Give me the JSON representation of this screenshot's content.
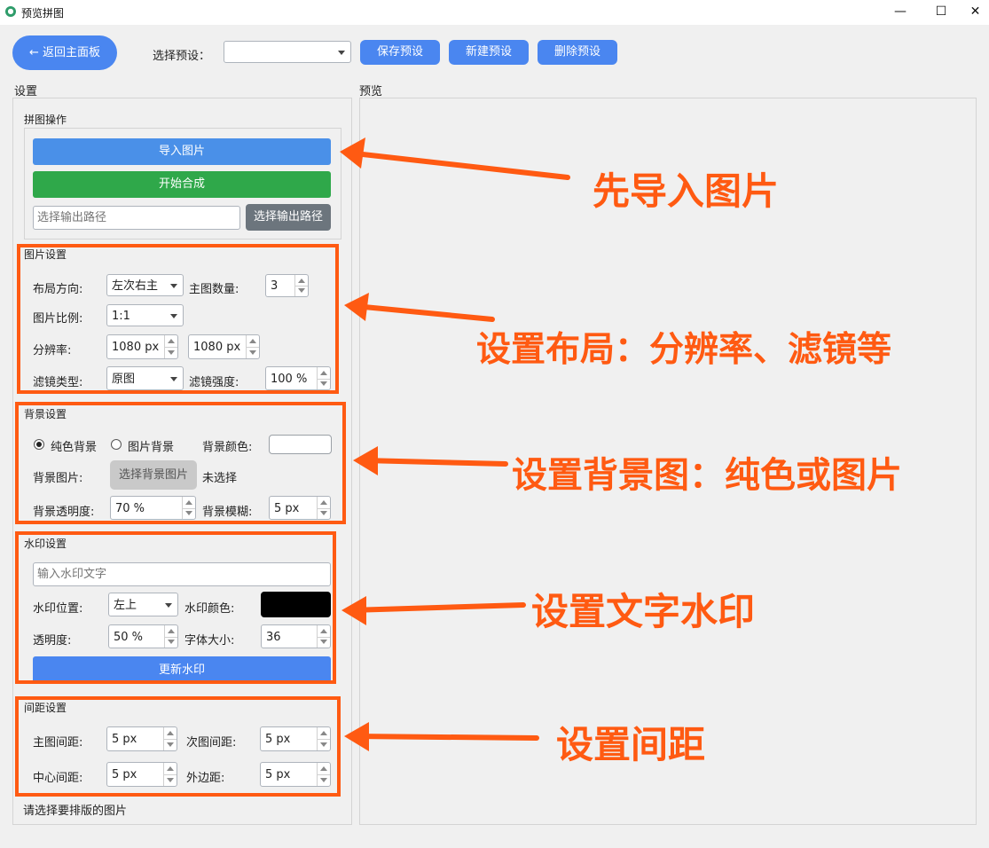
{
  "window": {
    "title": "预览拼图",
    "minimize": "—",
    "maximize": "☐",
    "close": "✕"
  },
  "toolbar": {
    "back_label": "← 返回主面板",
    "preset_label": "选择预设：",
    "preset_value": "",
    "save_label": "保存预设",
    "new_label": "新建预设",
    "delete_label": "删除预设"
  },
  "settings_title": "设置",
  "preview_title": "预览",
  "ops": {
    "title": "拼图操作",
    "import_label": "导入图片",
    "compose_label": "开始合成",
    "output_placeholder": "选择输出路径",
    "output_button": "选择输出路径"
  },
  "image_settings": {
    "title": "图片设置",
    "layout_label": "布局方向:",
    "layout_value": "左次右主",
    "main_count_label": "主图数量:",
    "main_count_value": "3",
    "ratio_label": "图片比例:",
    "ratio_value": "1:1",
    "resolution_label": "分辨率:",
    "res_w": "1080 px",
    "res_h": "1080 px",
    "filter_label": "滤镜类型:",
    "filter_value": "原图",
    "filter_strength_label": "滤镜强度:",
    "filter_strength_value": "100 %"
  },
  "background": {
    "title": "背景设置",
    "solid_label": "纯色背景",
    "image_label": "图片背景",
    "color_label": "背景颜色:",
    "color_value": "#ffffff",
    "bg_image_label": "背景图片:",
    "choose_bg_button": "选择背景图片",
    "not_selected": "未选择",
    "opacity_label": "背景透明度:",
    "opacity_value": "70 %",
    "blur_label": "背景模糊:",
    "blur_value": "5 px"
  },
  "watermark": {
    "title": "水印设置",
    "text_placeholder": "输入水印文字",
    "position_label": "水印位置:",
    "position_value": "左上",
    "color_label": "水印颜色:",
    "color_value": "#000000",
    "opacity_label": "透明度:",
    "opacity_value": "50 %",
    "font_size_label": "字体大小:",
    "font_size_value": "36",
    "update_button": "更新水印"
  },
  "spacing": {
    "title": "间距设置",
    "main_gap_label": "主图间距:",
    "main_gap_value": "5 px",
    "sub_gap_label": "次图间距:",
    "sub_gap_value": "5 px",
    "center_gap_label": "中心间距:",
    "center_gap_value": "5 px",
    "outer_margin_label": "外边距:",
    "outer_margin_value": "5 px"
  },
  "status_text": "请选择要排版的图片",
  "annotations": {
    "import": "先导入图片",
    "layout": "设置布局：分辨率、滤镜等",
    "background": "设置背景图：纯色或图片",
    "watermark": "设置文字水印",
    "spacing": "设置间距"
  },
  "colors": {
    "accent_blue": "#4a86f0",
    "green": "#2fa84a",
    "gray_button": "#6c757d",
    "annotation_orange": "#ff5a12"
  }
}
